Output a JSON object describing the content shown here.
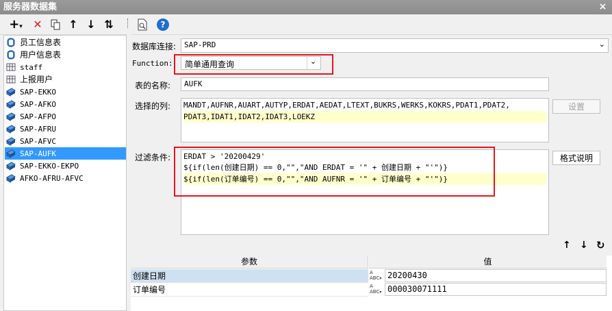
{
  "window": {
    "title": "服务器数据集",
    "close": "×"
  },
  "left_toolbar": {
    "icons": [
      "add-icon",
      "delete-icon",
      "copy-icon",
      "move-up-icon",
      "move-down-icon",
      "sort-icon"
    ],
    "add": "+",
    "add_arrow": "▾",
    "delete": "✕",
    "up": "↑",
    "down": "↓",
    "sort": "⇅"
  },
  "tree": {
    "items": [
      {
        "label": "员工信息表",
        "icon": "database-icon"
      },
      {
        "label": "用户信息表",
        "icon": "database-icon"
      },
      {
        "label": "staff",
        "icon": "table-icon"
      },
      {
        "label": "上报用户",
        "icon": "table-icon"
      },
      {
        "label": "SAP-EKKO",
        "icon": "dataset-icon"
      },
      {
        "label": "SAP-AFKO",
        "icon": "dataset-icon"
      },
      {
        "label": "SAP-AFPO",
        "icon": "dataset-icon"
      },
      {
        "label": "SAP-AFRU",
        "icon": "dataset-icon"
      },
      {
        "label": "SAP-AFVC",
        "icon": "dataset-icon"
      },
      {
        "label": "SAP-AUFK",
        "icon": "dataset-icon",
        "selected": true
      },
      {
        "label": "SAP-EKKO-EKPO",
        "icon": "dataset-icon"
      },
      {
        "label": "AFKO-AFRU-AFVC",
        "icon": "dataset-icon"
      }
    ]
  },
  "right_toolbar": {
    "icons": [
      "preview-icon",
      "help-icon"
    ],
    "help": "?"
  },
  "form": {
    "db_label": "数据库连接:",
    "db_value": "SAP-PRD",
    "function_label": "Function:",
    "function_value": "简单通用查询",
    "table_label": "表的名称:",
    "table_value": "AUFK",
    "columns_label": "选择的列:",
    "columns_lines": [
      "MANDT,AUFNR,AUART,AUTYP,ERDAT,AEDAT,LTEXT,BUKRS,WERKS,KOKRS,PDAT1,PDAT2,",
      "PDAT3,IDAT1,IDAT2,IDAT3,LOEKZ"
    ],
    "settings_button": "设置",
    "filter_label": "过滤条件:",
    "filter_lines": [
      "ERDAT > '20200429'",
      "${if(len(创建日期) == 0,\"\",\"AND ERDAT = '\" + 创建日期 + \"'\")}",
      "${if(len(订单编号) == 0,\"\",\"AND AUFNR = '\" + 订单编号 + \"'\")}"
    ],
    "format_button": "格式说明"
  },
  "param_controls": {
    "up": "↑",
    "down": "↓",
    "refresh": "↻"
  },
  "params": {
    "col_param": "参数",
    "col_value": "值",
    "rows": [
      {
        "name": "创建日期",
        "value": "20200430",
        "selected": true
      },
      {
        "name": "订单编号",
        "value": "000030071111",
        "selected": false
      }
    ]
  },
  "colors": {
    "highlight": "#ffffcc",
    "annotation": "#e8141c",
    "selection": "#3399ff",
    "row_selected": "#cfe0f2"
  }
}
